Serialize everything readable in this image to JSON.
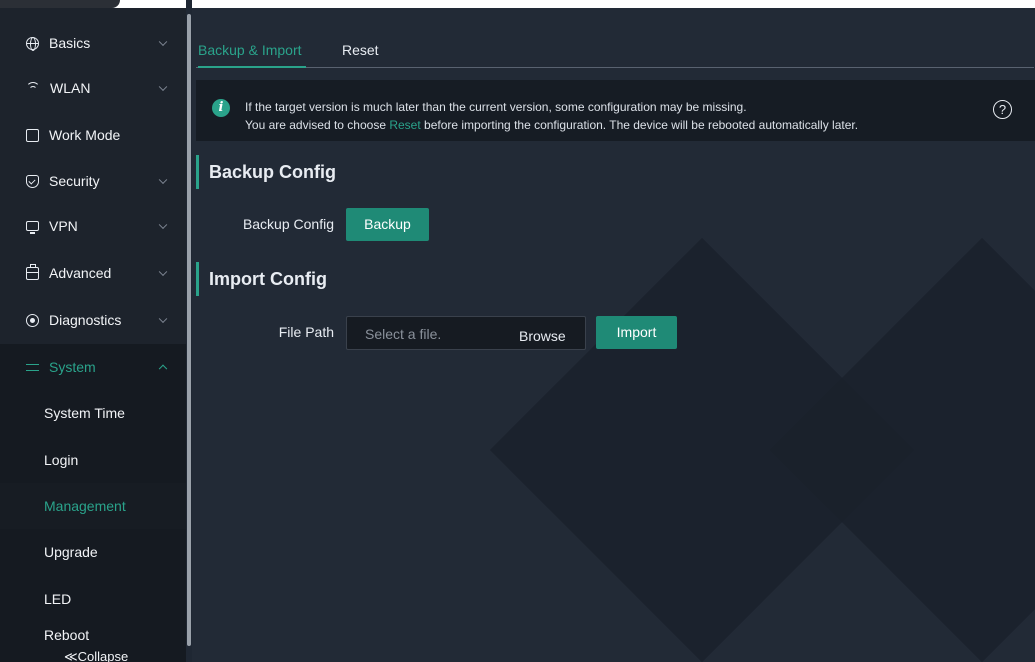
{
  "sidebar": {
    "items": [
      {
        "label": "Basics",
        "icon": "globe-icon"
      },
      {
        "label": "WLAN",
        "icon": "wifi-icon"
      },
      {
        "label": "Work Mode",
        "icon": "work-mode-icon"
      },
      {
        "label": "Security",
        "icon": "shield-icon"
      },
      {
        "label": "VPN",
        "icon": "vpn-icon"
      },
      {
        "label": "Advanced",
        "icon": "briefcase-icon"
      },
      {
        "label": "Diagnostics",
        "icon": "diagnostics-icon"
      },
      {
        "label": "System",
        "icon": "sliders-icon"
      }
    ],
    "system_sub": [
      "System Time",
      "Login",
      "Management",
      "Upgrade",
      "LED",
      "Reboot"
    ],
    "selected_sub": "Management",
    "collapse_label": "≪Collapse"
  },
  "tabs": [
    "Backup & Import",
    "Reset"
  ],
  "active_tab": "Backup & Import",
  "tip": {
    "line1": "If the target version is much later than the current version, some configuration may be missing.",
    "line2_before": "You are advised to choose ",
    "line2_link": "Reset",
    "line2_after": " before importing the configuration. The device will be rebooted automatically later."
  },
  "backup": {
    "section_title": "Backup Config",
    "field_label": "Backup Config",
    "button_label": "Backup"
  },
  "import": {
    "section_title": "Import Config",
    "field_label": "File Path",
    "placeholder": "Select a file.",
    "browse_label": "Browse",
    "button_label": "Import"
  },
  "colors": {
    "accent": "#2aa38b",
    "button": "#1f8a76",
    "sidebar_bg": "#1d232c",
    "main_bg": "#222a36"
  }
}
